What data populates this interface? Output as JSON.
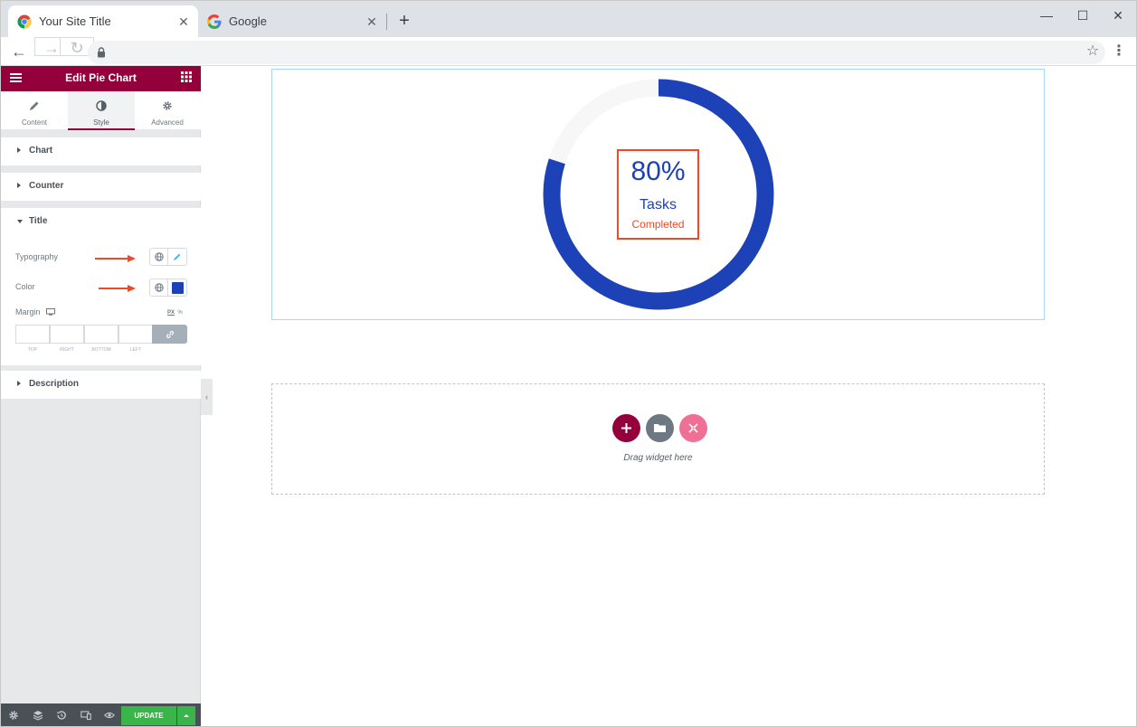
{
  "browser": {
    "tabs": [
      {
        "title": "Your Site Title",
        "active": true
      },
      {
        "title": "Google",
        "active": false
      }
    ]
  },
  "panel": {
    "header_title": "Edit Pie Chart",
    "tabs": [
      {
        "label": "Content",
        "icon": "pencil-icon"
      },
      {
        "label": "Style",
        "icon": "contrast-icon",
        "active": true
      },
      {
        "label": "Advanced",
        "icon": "gear-icon"
      }
    ],
    "sections": {
      "chart": "Chart",
      "counter": "Counter",
      "title": "Title",
      "description": "Description"
    },
    "controls": {
      "typography_label": "Typography",
      "color_label": "Color",
      "color_value": "#1d41b7",
      "margin_label": "Margin",
      "unit_px": "PX",
      "unit_percent": "%",
      "dims": [
        "TOP",
        "RIGHT",
        "BOTTOM",
        "LEFT"
      ]
    },
    "footer": {
      "update_label": "UPDATE"
    }
  },
  "widget": {
    "percent": "80%",
    "title": "Tasks",
    "description": "Completed",
    "progress_fraction": 0.8,
    "ring_color": "#1d41b7",
    "track_color": "#f7f7f7"
  },
  "dropzone": {
    "text": "Drag widget here"
  },
  "colors": {
    "brand": "#93003c",
    "accent_blue": "#1d41b7",
    "accent_red": "#ee4a27",
    "update_green": "#39b54a"
  }
}
